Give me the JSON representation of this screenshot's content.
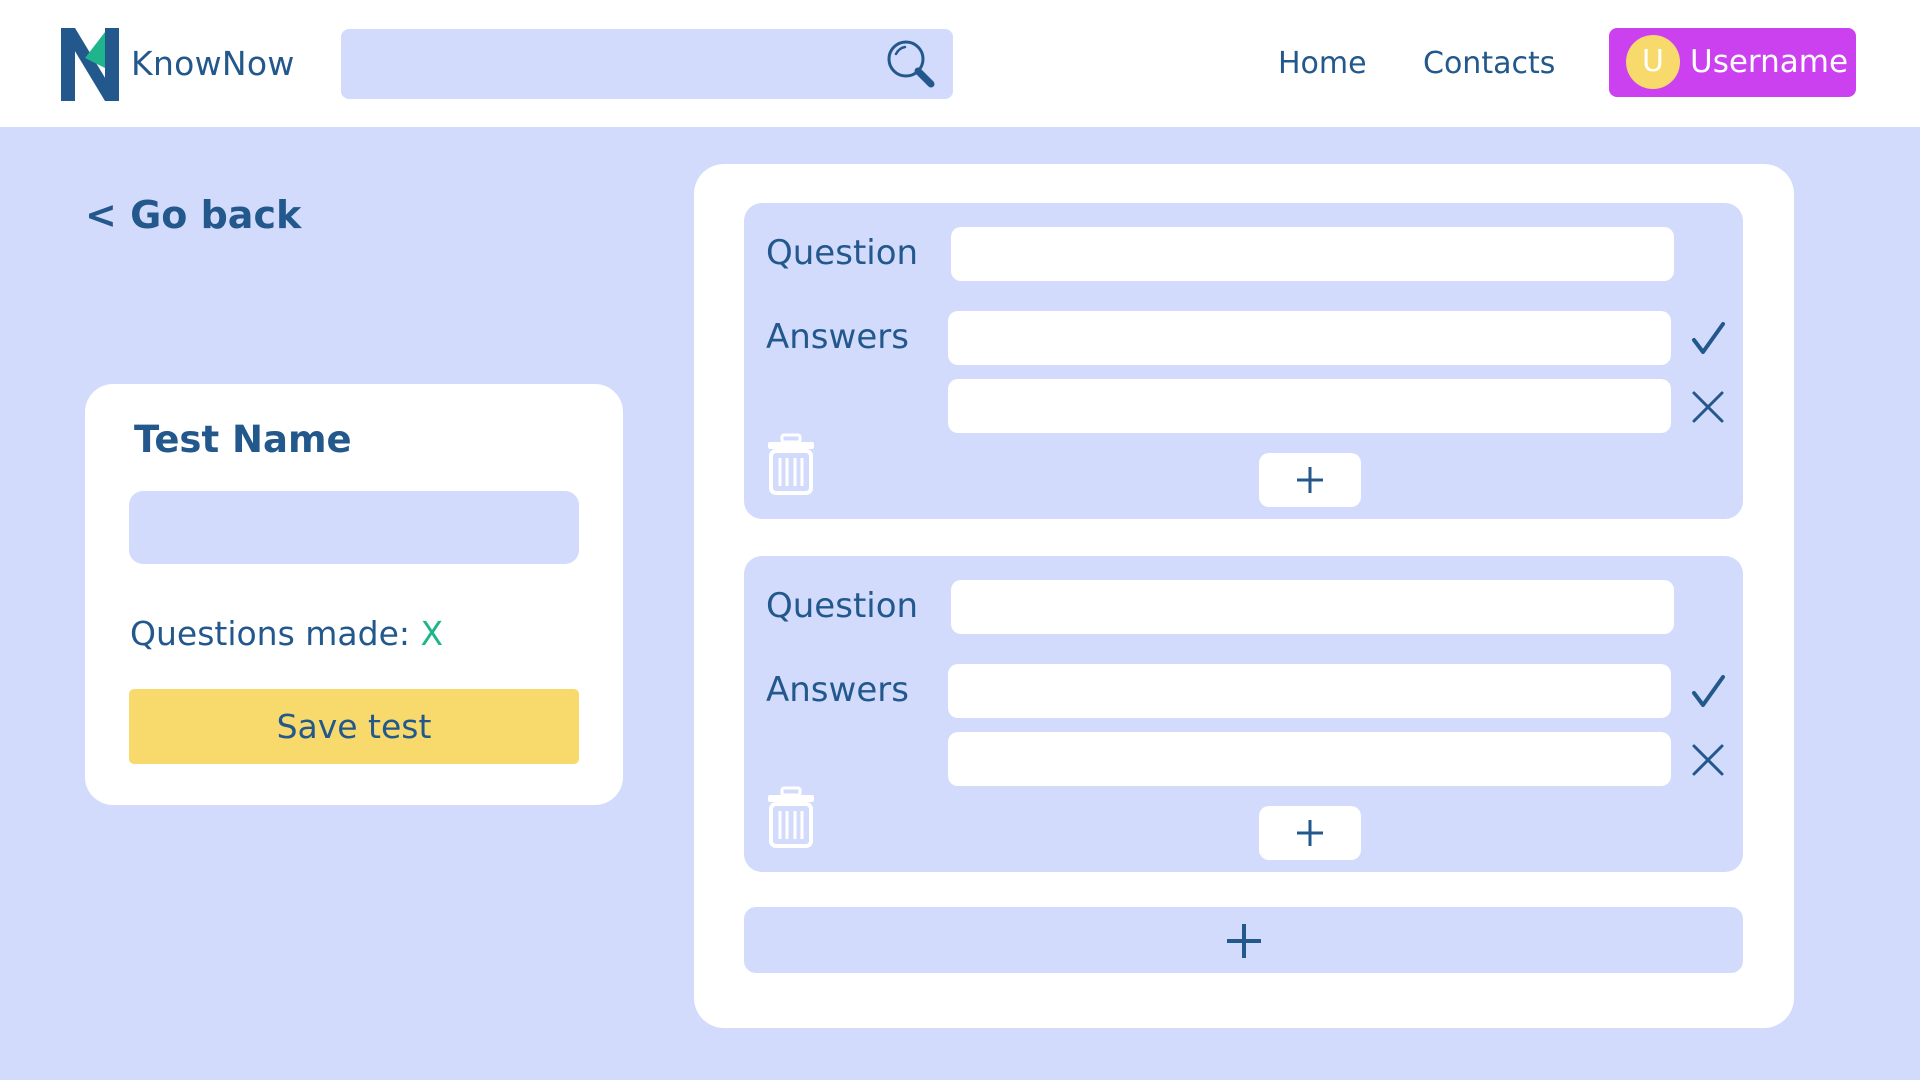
{
  "header": {
    "brand": "KnowNow",
    "search": {
      "placeholder": "",
      "value": ""
    },
    "nav": [
      {
        "label": "Home"
      },
      {
        "label": "Contacts"
      }
    ],
    "user": {
      "initial": "U",
      "name": "Username"
    }
  },
  "back_link": "< Go back",
  "test_card": {
    "title": "Test Name",
    "name_value": "",
    "questions_made_label": "Questions made: ",
    "questions_made_count": "X",
    "save_label": "Save test"
  },
  "editor": {
    "questions": [
      {
        "question_label": "Question",
        "question_value": "",
        "answers_label": "Answers",
        "answers": [
          {
            "value": "",
            "status": "correct"
          },
          {
            "value": "",
            "status": "incorrect"
          }
        ]
      },
      {
        "question_label": "Question",
        "question_value": "",
        "answers_label": "Answers",
        "answers": [
          {
            "value": "",
            "status": "correct"
          },
          {
            "value": "",
            "status": "incorrect"
          }
        ]
      }
    ]
  },
  "icons": {
    "logo": "knownow-logo",
    "search": "search-icon",
    "check": "check-icon",
    "cross": "close-icon",
    "trash": "trash-icon",
    "plus": "plus-icon"
  },
  "colors": {
    "background": "#d3dbfd",
    "primary_text": "#23588c",
    "user_button": "#cb41f0",
    "avatar": "#f7d96c",
    "save_button": "#f7d96c",
    "count_accent": "#1eb58c",
    "logo_accent": "#1eb58c"
  }
}
